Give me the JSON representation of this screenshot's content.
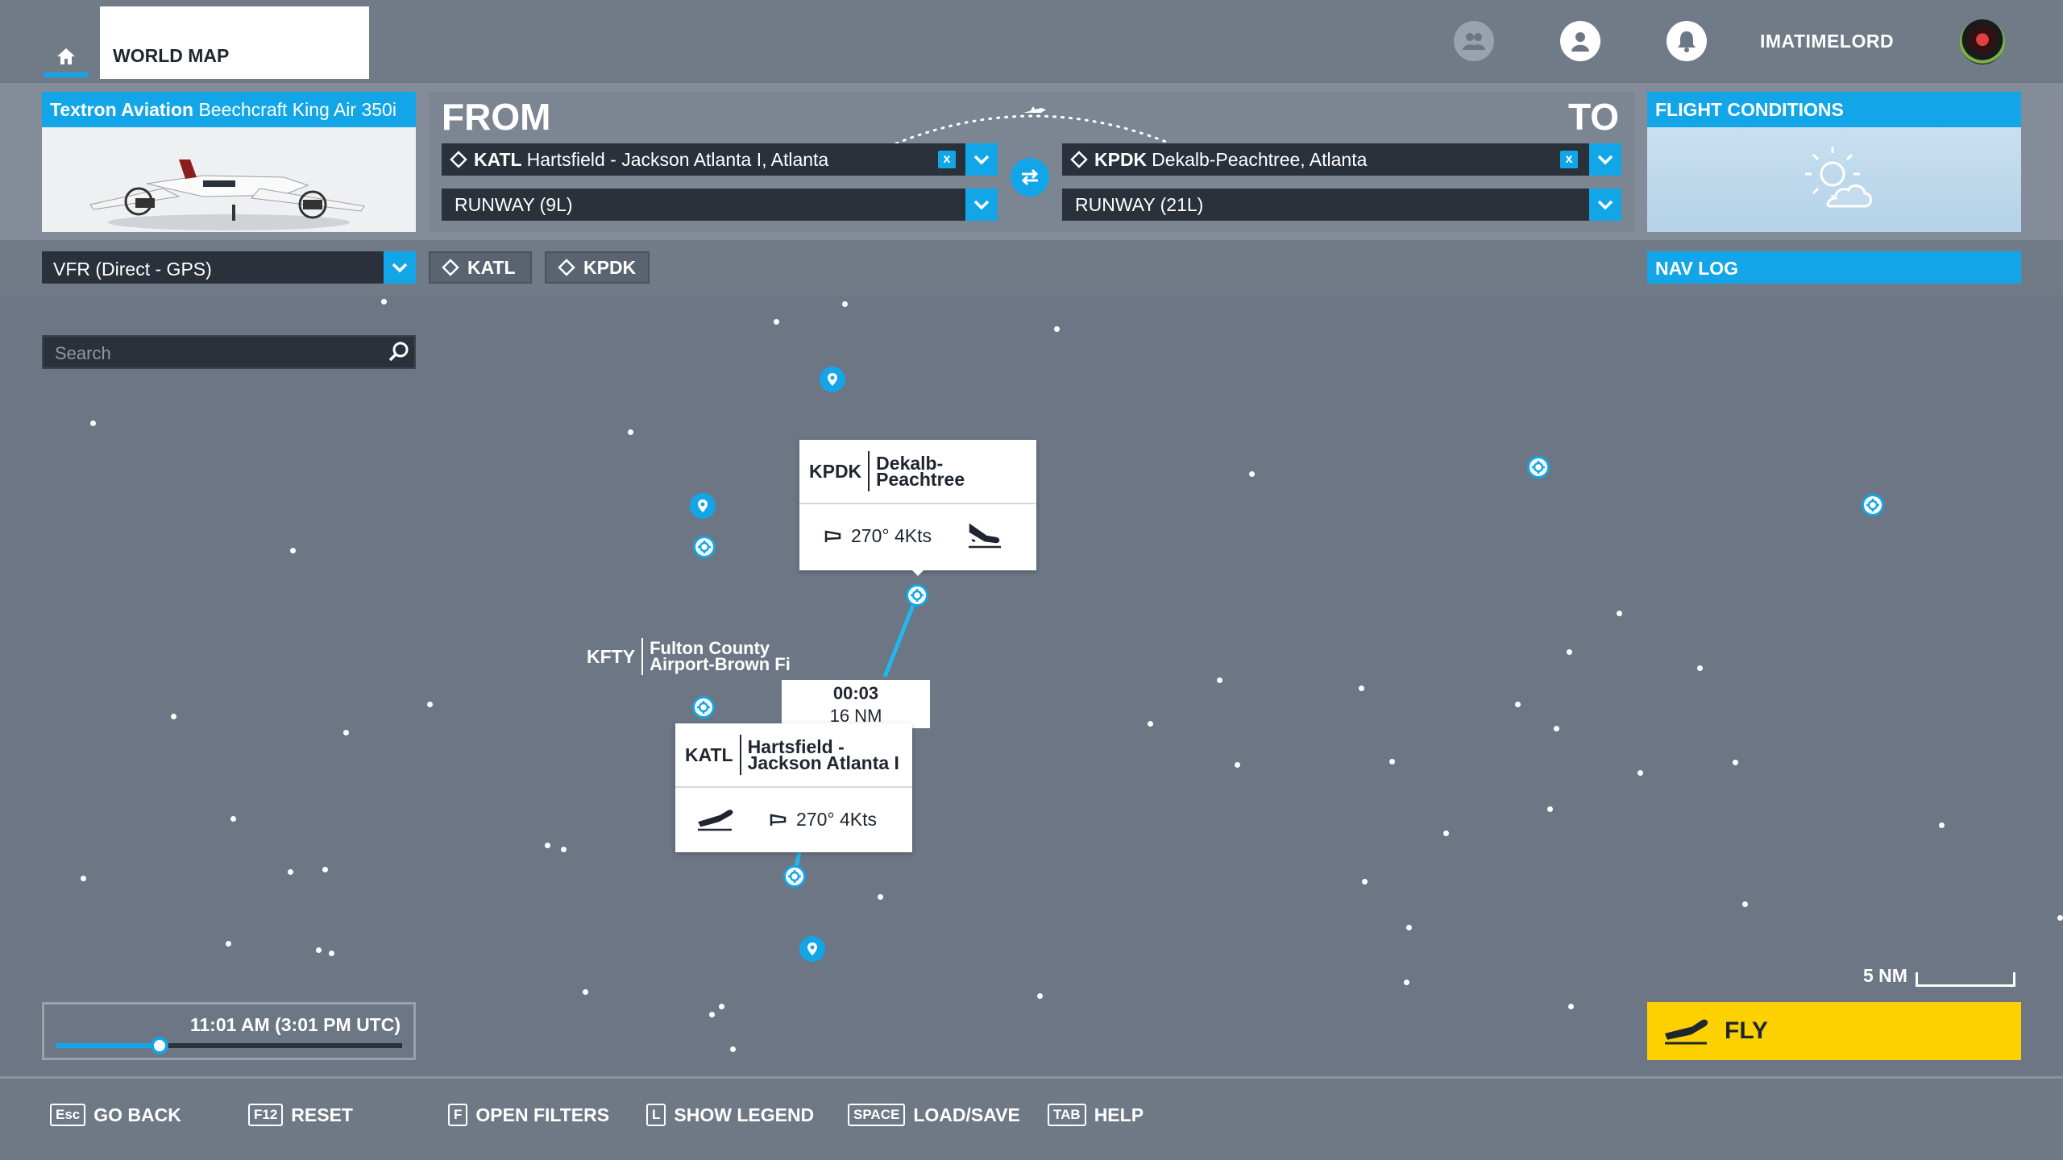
{
  "topbar": {
    "world_map": "WORLD MAP",
    "username": "IMATIMELORD",
    "icons": [
      "home-icon",
      "friends-icon",
      "profile-icon",
      "notifications-icon"
    ]
  },
  "aircraft": {
    "maker": "Textron Aviation",
    "model": "Beechcraft King Air 350i"
  },
  "route": {
    "from_label": "FROM",
    "to_label": "TO",
    "from_code": "KATL",
    "from_name": "Hartsfield - Jackson Atlanta I, Atlanta",
    "from_runway": "RUNWAY (9L)",
    "to_code": "KPDK",
    "to_name": "Dekalb-Peachtree, Atlanta",
    "to_runway": "RUNWAY (21L)",
    "clear_label": "x"
  },
  "conditions": {
    "title": "FLIGHT CONDITIONS"
  },
  "flight_type": "VFR (Direct - GPS)",
  "chips": [
    "KATL",
    "KPDK"
  ],
  "nav_log": "NAV LOG",
  "search": {
    "placeholder": "Search"
  },
  "map": {
    "destination": {
      "code": "KPDK",
      "name": "Dekalb-Peachtree",
      "wind": "270° 4Kts"
    },
    "departure": {
      "code": "KATL",
      "name_line1": "Hartsfield -",
      "name_line2": "Jackson Atlanta I",
      "wind": "270° 4Kts"
    },
    "leg": {
      "time": "00:03",
      "distance": "16 NM"
    },
    "kfty": {
      "code": "KFTY",
      "name_line1": "Fulton County",
      "name_line2": "Airport-Brown Fi"
    },
    "scale": "5 NM"
  },
  "time": {
    "label": "11:01 AM (3:01 PM UTC)",
    "progress": 0.3
  },
  "fly": "FLY",
  "hotkeys": [
    {
      "key": "Esc",
      "label": "GO BACK"
    },
    {
      "key": "F12",
      "label": "RESET"
    },
    {
      "key": "F",
      "label": "OPEN FILTERS"
    },
    {
      "key": "L",
      "label": "SHOW LEGEND"
    },
    {
      "key": "SPACE",
      "label": "LOAD/SAVE"
    },
    {
      "key": "TAB",
      "label": "HELP"
    }
  ],
  "colors": {
    "accent": "#12a6e8",
    "fly": "#fdd000",
    "map": "#6c7684"
  }
}
